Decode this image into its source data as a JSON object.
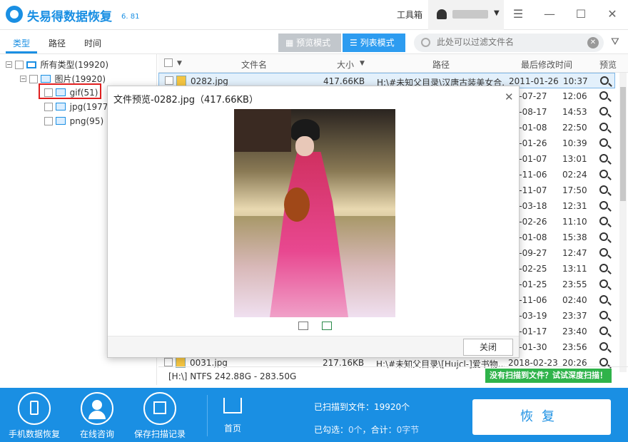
{
  "app": {
    "title": "失易得数据恢复",
    "version": "6. 81",
    "toolbox_label": "工具箱",
    "window_controls": [
      "menu-icon",
      "minimize-icon",
      "maximize-icon",
      "close-icon"
    ]
  },
  "tabs": {
    "items": [
      {
        "label": "类型",
        "active": true
      },
      {
        "label": "路径",
        "active": false
      },
      {
        "label": "时间",
        "active": false
      }
    ],
    "preview_mode_label": "预览模式",
    "list_mode_label": "列表模式"
  },
  "search": {
    "placeholder": "此处可以过滤文件名",
    "value": ""
  },
  "tree": [
    {
      "label": "所有类型(19920)",
      "level": 0
    },
    {
      "label": "图片(19920)",
      "level": 1
    },
    {
      "label": "gif(51)",
      "level": 2
    },
    {
      "label": "jpg(19774",
      "level": 2
    },
    {
      "label": "png(95)",
      "level": 2
    }
  ],
  "list": {
    "columns": [
      "文件名",
      "大小",
      "路径",
      "最后修改时间",
      "预览"
    ],
    "rows": [
      {
        "name": "0282.jpg",
        "size": "417.66KB",
        "path": "H:\\#未知父目录\\汉唐古装美女合...",
        "date": "2011-01-26",
        "time": "10:37",
        "selected": true
      },
      {
        "name": "",
        "size": "",
        "path": "",
        "date": "09-07-27",
        "time": "12:06"
      },
      {
        "name": "",
        "size": "",
        "path": "",
        "date": "09-08-17",
        "time": "14:53"
      },
      {
        "name": "",
        "size": "",
        "path": "",
        "date": "09-01-08",
        "time": "22:50"
      },
      {
        "name": "",
        "size": "",
        "path": "",
        "date": "11-01-26",
        "time": "10:39"
      },
      {
        "name": "",
        "size": "",
        "path": "",
        "date": "09-01-07",
        "time": "13:01"
      },
      {
        "name": "",
        "size": "",
        "path": "",
        "date": "11-11-06",
        "time": "02:24"
      },
      {
        "name": "",
        "size": "",
        "path": "",
        "date": "08-11-07",
        "time": "17:50"
      },
      {
        "name": "",
        "size": "",
        "path": "",
        "date": "12-03-18",
        "time": "12:31"
      },
      {
        "name": "",
        "size": "",
        "path": "",
        "date": "13-02-26",
        "time": "11:10"
      },
      {
        "name": "",
        "size": "",
        "path": "",
        "date": "09-01-08",
        "time": "15:38"
      },
      {
        "name": "",
        "size": "",
        "path": "",
        "date": "13-09-27",
        "time": "12:47"
      },
      {
        "name": "",
        "size": "",
        "path": "",
        "date": "13-02-25",
        "time": "13:11"
      },
      {
        "name": "",
        "size": "",
        "path": "",
        "date": "11-01-25",
        "time": "23:55"
      },
      {
        "name": "",
        "size": "",
        "path": "",
        "date": "11-11-06",
        "time": "02:40"
      },
      {
        "name": "",
        "size": "",
        "path": "",
        "date": "19-03-19",
        "time": "23:37"
      },
      {
        "name": "",
        "size": "",
        "path": "",
        "date": "19-01-17",
        "time": "23:40"
      },
      {
        "name": "",
        "size": "",
        "path": "",
        "date": "19-01-30",
        "time": "23:56"
      },
      {
        "name": "0031.jpg",
        "size": "217.16KB",
        "path": "H:\\#未知父目录\\[Hujcl-]爱书物...",
        "date": "2018-02-23",
        "time": "20:26"
      }
    ]
  },
  "status": {
    "disk_info": "[H:\\] NTFS 242.88G - 283.50G",
    "deep_scan_label": "没有扫描到文件？试试深度扫描！"
  },
  "dialog": {
    "title": "文件预览-0282.jpg（417.66KB）",
    "close_label": "关闭"
  },
  "bottom": {
    "items": [
      {
        "label": "手机数据恢复",
        "icon": "phone-icon"
      },
      {
        "label": "在线咨询",
        "icon": "user-icon"
      },
      {
        "label": "保存扫描记录",
        "icon": "save-icon"
      }
    ],
    "home_label": "首页",
    "scanned_label": "已扫描到文件：19920个",
    "selected_prefix": "已勾选：",
    "selected_count": "0个",
    "total_prefix": "，合计：",
    "total_size": "0字节",
    "recover_label": "恢复"
  }
}
